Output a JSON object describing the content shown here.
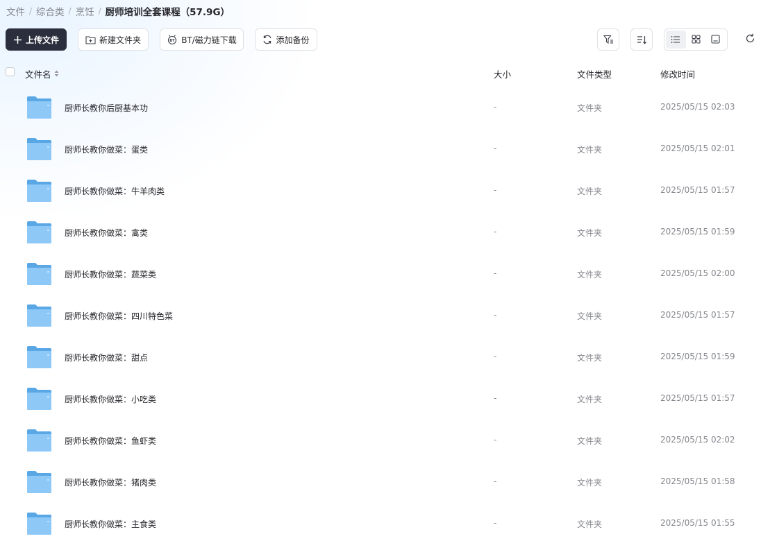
{
  "breadcrumb": [
    "文件",
    "综合类",
    "烹饪",
    "厨师培训全套课程（57.9G）"
  ],
  "breadcrumb_separator": "/",
  "toolbar": {
    "upload_label": "上传文件",
    "new_folder_label": "新建文件夹",
    "bt_label": "BT/磁力链下载",
    "backup_label": "添加备份"
  },
  "icons": {
    "upload": "plus-icon",
    "new_folder": "folder-plus-icon",
    "bt": "bt-icon",
    "backup": "sync-icon",
    "filter": "filter-icon",
    "sort": "sort-icon",
    "list_view": "list-view-icon",
    "grid_view": "grid-view-icon",
    "preview_view": "preview-view-icon",
    "refresh": "refresh-icon",
    "folder": "folder-icon"
  },
  "table": {
    "columns": {
      "name": "文件名",
      "size": "大小",
      "type": "文件类型",
      "modified": "修改时间"
    },
    "rows": [
      {
        "name": "厨师长教你后厨基本功",
        "size": "-",
        "type": "文件夹",
        "modified": "2025/05/15 02:03"
      },
      {
        "name": "厨师长教你做菜：蛋类",
        "size": "-",
        "type": "文件夹",
        "modified": "2025/05/15 02:01"
      },
      {
        "name": "厨师长教你做菜：牛羊肉类",
        "size": "-",
        "type": "文件夹",
        "modified": "2025/05/15 01:57"
      },
      {
        "name": "厨师长教你做菜：禽类",
        "size": "-",
        "type": "文件夹",
        "modified": "2025/05/15 01:59"
      },
      {
        "name": "厨师长教你做菜：蔬菜类",
        "size": "-",
        "type": "文件夹",
        "modified": "2025/05/15 02:00"
      },
      {
        "name": "厨师长教你做菜：四川特色菜",
        "size": "-",
        "type": "文件夹",
        "modified": "2025/05/15 01:57"
      },
      {
        "name": "厨师长教你做菜：甜点",
        "size": "-",
        "type": "文件夹",
        "modified": "2025/05/15 01:59"
      },
      {
        "name": "厨师长教你做菜：小吃类",
        "size": "-",
        "type": "文件夹",
        "modified": "2025/05/15 01:57"
      },
      {
        "name": "厨师长教你做菜：鱼虾类",
        "size": "-",
        "type": "文件夹",
        "modified": "2025/05/15 02:02"
      },
      {
        "name": "厨师长教你做菜：猪肉类",
        "size": "-",
        "type": "文件夹",
        "modified": "2025/05/15 01:58"
      },
      {
        "name": "厨师长教你做菜：主食类",
        "size": "-",
        "type": "文件夹",
        "modified": "2025/05/15 01:55"
      }
    ]
  },
  "colors": {
    "primary_button": "#2b2f3d",
    "folder_blue": "#6cb6f2",
    "muted_text": "#84868c"
  }
}
